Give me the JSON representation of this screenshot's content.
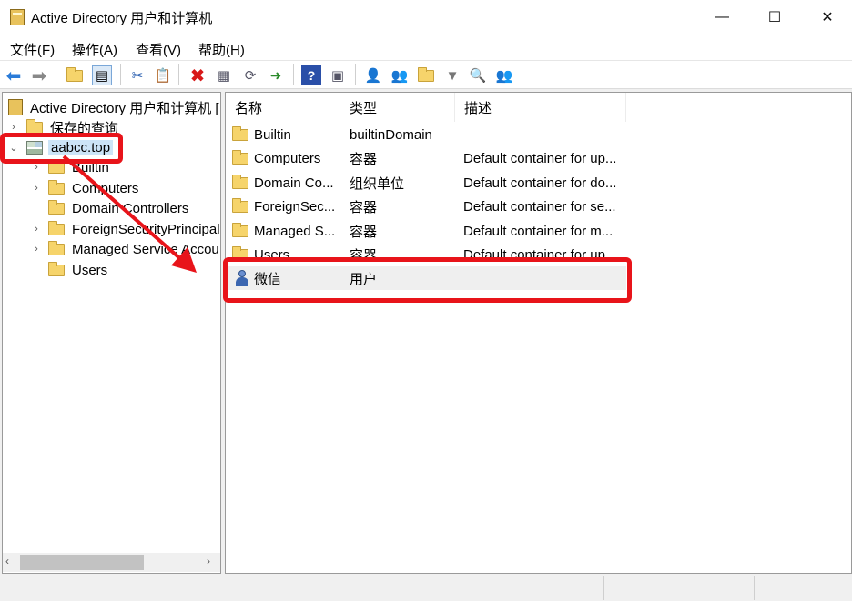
{
  "window": {
    "title": "Active Directory 用户和计算机",
    "minimize_glyph": "—",
    "maximize_glyph": "☐",
    "close_glyph": "✕"
  },
  "menu": [
    "文件(F)",
    "操作(A)",
    "查看(V)",
    "帮助(H)"
  ],
  "toolbar": {
    "icons": [
      "back-arrow-icon",
      "forward-arrow-icon",
      "up-folder-icon",
      "show-hide-tree-icon",
      "cut-icon",
      "copy-icon",
      "delete-icon",
      "properties-icon",
      "refresh-icon",
      "export-list-icon",
      "help-icon",
      "action-pane-icon",
      "new-user-icon",
      "new-group-icon",
      "new-ou-icon",
      "filter-icon",
      "find-icon",
      "add-to-group-icon"
    ]
  },
  "tree": {
    "root": "Active Directory 用户和计算机 [",
    "saved_queries": "保存的查询",
    "domain": "aabcc.top",
    "children": [
      "Builtin",
      "Computers",
      "Domain Controllers",
      "ForeignSecurityPrincipal",
      "Managed Service Accou",
      "Users"
    ]
  },
  "list": {
    "headers": [
      "名称",
      "类型",
      "描述"
    ],
    "rows": [
      {
        "name": "Builtin",
        "type": "builtinDomain",
        "desc": ""
      },
      {
        "name": "Computers",
        "type": "容器",
        "desc": "Default container for up..."
      },
      {
        "name": "Domain Co...",
        "type": "组织单位",
        "desc": "Default container for do..."
      },
      {
        "name": "ForeignSec...",
        "type": "容器",
        "desc": "Default container for se..."
      },
      {
        "name": "Managed S...",
        "type": "容器",
        "desc": "Default container for m..."
      },
      {
        "name": "Users",
        "type": "容器",
        "desc": "Default container for up..."
      },
      {
        "name": "微信",
        "type": "用户",
        "desc": ""
      }
    ]
  },
  "annotation_color": "#e8141a"
}
